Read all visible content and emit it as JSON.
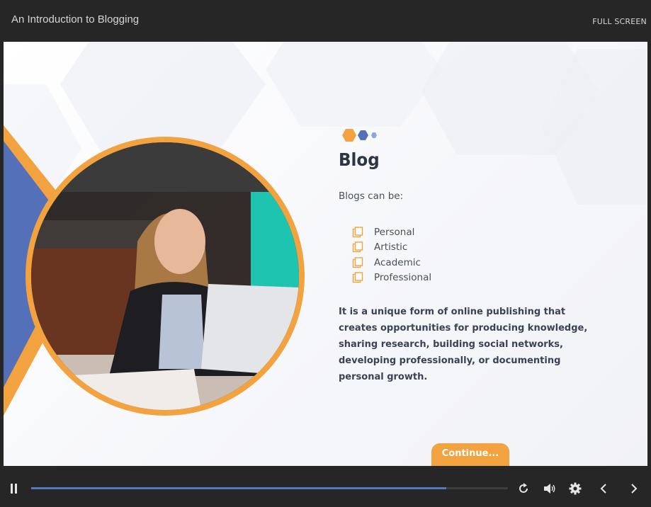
{
  "header": {
    "course_title": "An Introduction to Blogging",
    "fullscreen_label": "FULL SCREEN"
  },
  "slide": {
    "heading": "Blog",
    "intro": "Blogs can be:",
    "list_items": [
      "Personal",
      "Artistic",
      "Academic",
      "Professional"
    ],
    "list_icon": "copy-icon",
    "paragraph": "It is a unique form of online publishing that creates opportunities for producing knowledge, sharing research, building social networks, developing professionally, or documenting personal growth.",
    "continue_label": "Continue..."
  },
  "player": {
    "progress_fraction": 0.87,
    "controls": [
      "pause-icon",
      "replay-icon",
      "volume-icon",
      "settings-icon",
      "previous-icon",
      "next-icon"
    ]
  },
  "colors": {
    "accent_orange": "#f2a23e",
    "accent_blue": "#5470b8",
    "heading": "#2d3446",
    "player_bar": "#262626"
  }
}
